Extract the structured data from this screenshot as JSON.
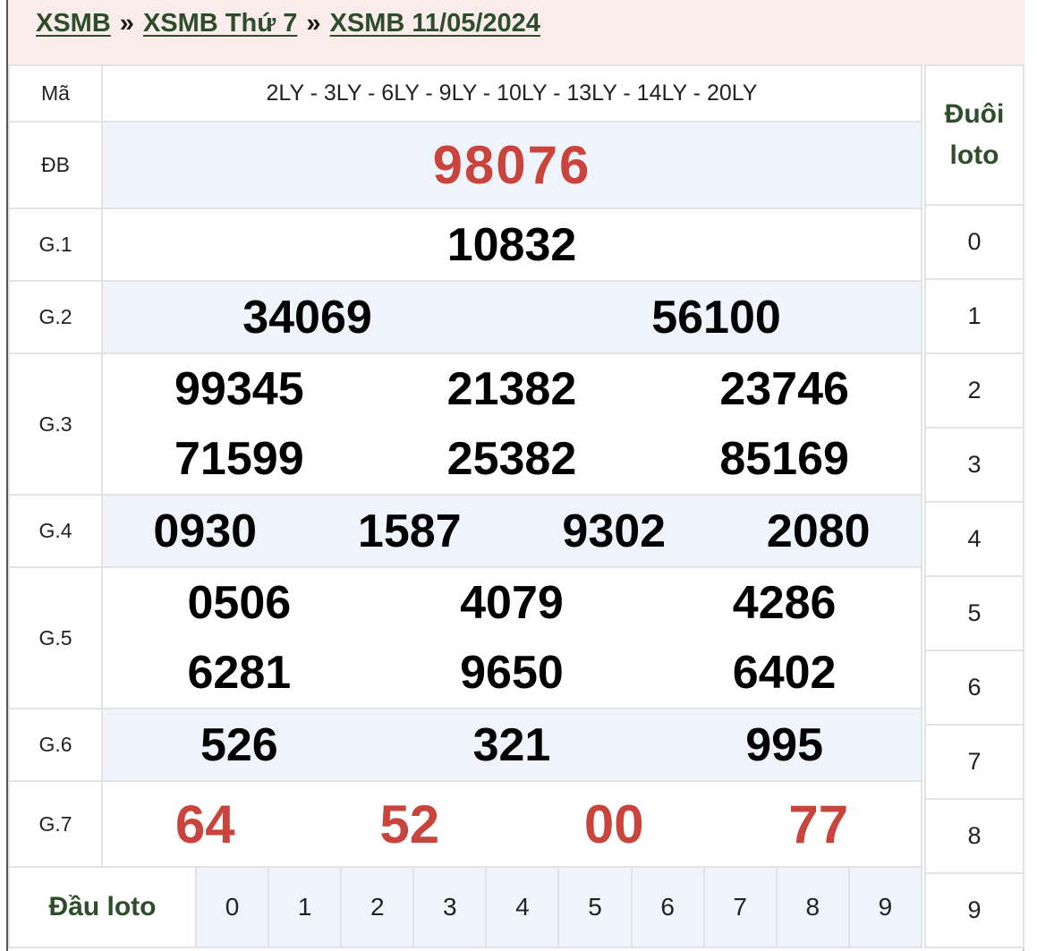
{
  "breadcrumb": {
    "items": [
      "XSMB",
      "XSMB Thứ 7",
      "XSMB 11/05/2024"
    ],
    "separator": "»"
  },
  "codes": {
    "label": "Mã",
    "value": "2LY - 3LY - 6LY - 9LY - 10LY - 13LY - 14LY - 20LY"
  },
  "prizes": {
    "db": {
      "label": "ĐB",
      "numbers": [
        "98076"
      ]
    },
    "g1": {
      "label": "G.1",
      "numbers": [
        "10832"
      ]
    },
    "g2": {
      "label": "G.2",
      "numbers": [
        "34069",
        "56100"
      ]
    },
    "g3": {
      "label": "G.3",
      "numbers": [
        "99345",
        "21382",
        "23746",
        "71599",
        "25382",
        "85169"
      ]
    },
    "g4": {
      "label": "G.4",
      "numbers": [
        "0930",
        "1587",
        "9302",
        "2080"
      ]
    },
    "g5": {
      "label": "G.5",
      "numbers": [
        "0506",
        "4079",
        "4286",
        "6281",
        "9650",
        "6402"
      ]
    },
    "g6": {
      "label": "G.6",
      "numbers": [
        "526",
        "321",
        "995"
      ]
    },
    "g7": {
      "label": "G.7",
      "numbers": [
        "64",
        "52",
        "00",
        "77"
      ]
    }
  },
  "duoi_loto": {
    "header_line1": "Đuôi",
    "header_line2": "loto",
    "digits": [
      "0",
      "1",
      "2",
      "3",
      "4",
      "5",
      "6",
      "7",
      "8",
      "9"
    ]
  },
  "dau_loto": {
    "header": "Đầu loto",
    "digits": [
      "0",
      "1",
      "2",
      "3",
      "4",
      "5",
      "6",
      "7",
      "8",
      "9"
    ]
  },
  "colors": {
    "accent_red": "#c9443d",
    "accent_green": "#2e4d2b",
    "row_highlight": "#eff3fb",
    "breadcrumb_bg": "#f9eceb"
  }
}
